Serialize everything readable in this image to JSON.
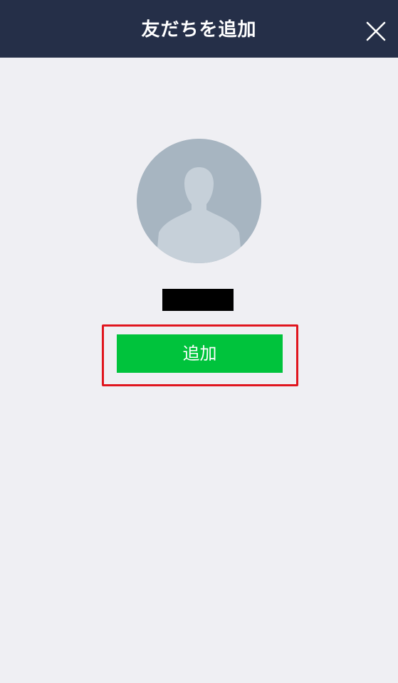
{
  "header": {
    "title": "友だちを追加",
    "close_icon": "close-icon"
  },
  "profile": {
    "avatar_icon": "default-person-silhouette-icon",
    "name_redacted": true
  },
  "actions": {
    "add_label": "追加"
  },
  "colors": {
    "header_background": "#252f48",
    "page_background": "#efeff3",
    "avatar_background": "#a7b5c1",
    "avatar_silhouette": "#c6d0d9",
    "add_button": "#00c33c",
    "highlight_frame": "#e0151e"
  }
}
